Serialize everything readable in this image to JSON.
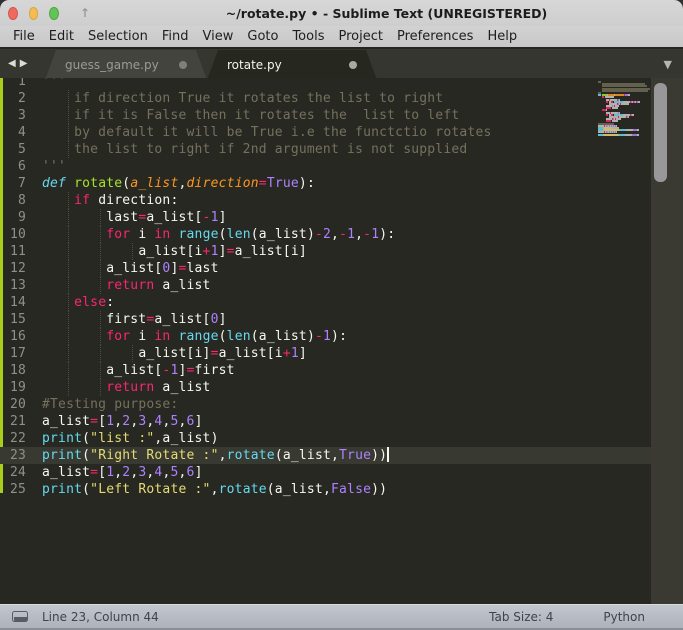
{
  "window": {
    "title": "~/rotate.py • - Sublime Text (UNREGISTERED)"
  },
  "menu": {
    "items": [
      "File",
      "Edit",
      "Selection",
      "Find",
      "View",
      "Goto",
      "Tools",
      "Project",
      "Preferences",
      "Help"
    ]
  },
  "tabs": [
    {
      "label": "guess_game.py",
      "active": false,
      "modified": true
    },
    {
      "label": "rotate.py",
      "active": true,
      "modified": true
    }
  ],
  "editor": {
    "cursor": {
      "line": 23,
      "column": 44
    },
    "current_line": 23,
    "colors": {
      "background": "#272822",
      "foreground": "#f8f8f2",
      "comment": "#75715e",
      "keyword": "#f92672",
      "builtin": "#66d9ef",
      "function_name": "#a6e22e",
      "parameter": "#fd971f",
      "number": "#ae81ff",
      "string": "#e6db74",
      "line_number": "#8f908a",
      "modified_indicator": "#a8ce1a",
      "current_line_bg": "#383931"
    },
    "lines": [
      {
        "n": 1,
        "tokens": [
          [
            "com",
            "'''"
          ]
        ]
      },
      {
        "n": 2,
        "tokens": [
          [
            "com",
            "    if direction True it rotates the list to right"
          ]
        ]
      },
      {
        "n": 3,
        "tokens": [
          [
            "com",
            "    if it is False then it rotates the  list to left"
          ]
        ]
      },
      {
        "n": 4,
        "tokens": [
          [
            "com",
            "    by default it will be True i.e the functctio rotates"
          ]
        ]
      },
      {
        "n": 5,
        "tokens": [
          [
            "com",
            "    the list to right if 2nd argument is not supplied"
          ]
        ]
      },
      {
        "n": 6,
        "tokens": [
          [
            "com",
            "'''"
          ]
        ]
      },
      {
        "n": 7,
        "tokens": [
          [
            "cyi",
            "def"
          ],
          [
            "fg",
            " "
          ],
          [
            "fn",
            "rotate"
          ],
          [
            "fg",
            "("
          ],
          [
            "par",
            "a_list"
          ],
          [
            "fg",
            ","
          ],
          [
            "par",
            "direction"
          ],
          [
            "kw",
            "="
          ],
          [
            "num",
            "True"
          ],
          [
            "fg",
            "):"
          ]
        ]
      },
      {
        "n": 8,
        "tokens": [
          [
            "fg",
            "    "
          ],
          [
            "kw",
            "if"
          ],
          [
            "fg",
            " direction:"
          ]
        ]
      },
      {
        "n": 9,
        "tokens": [
          [
            "fg",
            "        last"
          ],
          [
            "kw",
            "="
          ],
          [
            "fg",
            "a_list["
          ],
          [
            "kw",
            "-"
          ],
          [
            "num",
            "1"
          ],
          [
            "fg",
            "]"
          ]
        ]
      },
      {
        "n": 10,
        "tokens": [
          [
            "fg",
            "        "
          ],
          [
            "kw",
            "for"
          ],
          [
            "fg",
            " i "
          ],
          [
            "kw",
            "in"
          ],
          [
            "fg",
            " "
          ],
          [
            "cy",
            "range"
          ],
          [
            "fg",
            "("
          ],
          [
            "cy",
            "len"
          ],
          [
            "fg",
            "(a_list)"
          ],
          [
            "kw",
            "-"
          ],
          [
            "num",
            "2"
          ],
          [
            "fg",
            ","
          ],
          [
            "kw",
            "-"
          ],
          [
            "num",
            "1"
          ],
          [
            "fg",
            ","
          ],
          [
            "kw",
            "-"
          ],
          [
            "num",
            "1"
          ],
          [
            "fg",
            "):"
          ]
        ]
      },
      {
        "n": 11,
        "tokens": [
          [
            "fg",
            "            a_list[i"
          ],
          [
            "kw",
            "+"
          ],
          [
            "num",
            "1"
          ],
          [
            "fg",
            "]"
          ],
          [
            "kw",
            "="
          ],
          [
            "fg",
            "a_list[i]"
          ]
        ]
      },
      {
        "n": 12,
        "tokens": [
          [
            "fg",
            "        a_list["
          ],
          [
            "num",
            "0"
          ],
          [
            "fg",
            "]"
          ],
          [
            "kw",
            "="
          ],
          [
            "fg",
            "last"
          ]
        ]
      },
      {
        "n": 13,
        "tokens": [
          [
            "fg",
            "        "
          ],
          [
            "kw",
            "return"
          ],
          [
            "fg",
            " a_list"
          ]
        ]
      },
      {
        "n": 14,
        "tokens": [
          [
            "fg",
            "    "
          ],
          [
            "kw",
            "else"
          ],
          [
            "fg",
            ":"
          ]
        ]
      },
      {
        "n": 15,
        "tokens": [
          [
            "fg",
            "        first"
          ],
          [
            "kw",
            "="
          ],
          [
            "fg",
            "a_list["
          ],
          [
            "num",
            "0"
          ],
          [
            "fg",
            "]"
          ]
        ]
      },
      {
        "n": 16,
        "tokens": [
          [
            "fg",
            "        "
          ],
          [
            "kw",
            "for"
          ],
          [
            "fg",
            " i "
          ],
          [
            "kw",
            "in"
          ],
          [
            "fg",
            " "
          ],
          [
            "cy",
            "range"
          ],
          [
            "fg",
            "("
          ],
          [
            "cy",
            "len"
          ],
          [
            "fg",
            "(a_list)"
          ],
          [
            "kw",
            "-"
          ],
          [
            "num",
            "1"
          ],
          [
            "fg",
            "):"
          ]
        ]
      },
      {
        "n": 17,
        "tokens": [
          [
            "fg",
            "            a_list[i]"
          ],
          [
            "kw",
            "="
          ],
          [
            "fg",
            "a_list[i"
          ],
          [
            "kw",
            "+"
          ],
          [
            "num",
            "1"
          ],
          [
            "fg",
            "]"
          ]
        ]
      },
      {
        "n": 18,
        "tokens": [
          [
            "fg",
            "        a_list["
          ],
          [
            "kw",
            "-"
          ],
          [
            "num",
            "1"
          ],
          [
            "fg",
            "]"
          ],
          [
            "kw",
            "="
          ],
          [
            "fg",
            "first"
          ]
        ]
      },
      {
        "n": 19,
        "tokens": [
          [
            "fg",
            "        "
          ],
          [
            "kw",
            "return"
          ],
          [
            "fg",
            " a_list"
          ]
        ]
      },
      {
        "n": 20,
        "tokens": [
          [
            "com",
            "#Testing purpose:"
          ]
        ]
      },
      {
        "n": 21,
        "tokens": [
          [
            "fg",
            "a_list"
          ],
          [
            "kw",
            "="
          ],
          [
            "fg",
            "["
          ],
          [
            "num",
            "1"
          ],
          [
            "fg",
            ","
          ],
          [
            "num",
            "2"
          ],
          [
            "fg",
            ","
          ],
          [
            "num",
            "3"
          ],
          [
            "fg",
            ","
          ],
          [
            "num",
            "4"
          ],
          [
            "fg",
            ","
          ],
          [
            "num",
            "5"
          ],
          [
            "fg",
            ","
          ],
          [
            "num",
            "6"
          ],
          [
            "fg",
            "]"
          ]
        ]
      },
      {
        "n": 22,
        "tokens": [
          [
            "cy",
            "print"
          ],
          [
            "fg",
            "("
          ],
          [
            "str",
            "\"list :\""
          ],
          [
            "fg",
            ",a_list)"
          ]
        ]
      },
      {
        "n": 23,
        "tokens": [
          [
            "cy",
            "print"
          ],
          [
            "fg",
            "("
          ],
          [
            "str",
            "\"Right Rotate :\""
          ],
          [
            "fg",
            ","
          ],
          [
            "cy",
            "rotate"
          ],
          [
            "fg",
            "(a_list,"
          ],
          [
            "num",
            "True"
          ],
          [
            "fg",
            "))"
          ]
        ]
      },
      {
        "n": 24,
        "tokens": [
          [
            "fg",
            "a_list"
          ],
          [
            "kw",
            "="
          ],
          [
            "fg",
            "["
          ],
          [
            "num",
            "1"
          ],
          [
            "fg",
            ","
          ],
          [
            "num",
            "2"
          ],
          [
            "fg",
            ","
          ],
          [
            "num",
            "3"
          ],
          [
            "fg",
            ","
          ],
          [
            "num",
            "4"
          ],
          [
            "fg",
            ","
          ],
          [
            "num",
            "5"
          ],
          [
            "fg",
            ","
          ],
          [
            "num",
            "6"
          ],
          [
            "fg",
            "]"
          ]
        ]
      },
      {
        "n": 25,
        "tokens": [
          [
            "cy",
            "print"
          ],
          [
            "fg",
            "("
          ],
          [
            "str",
            "\"Left Rotate :\""
          ],
          [
            "fg",
            ","
          ],
          [
            "cy",
            "rotate"
          ],
          [
            "fg",
            "(a_list,"
          ],
          [
            "num",
            "False"
          ],
          [
            "fg",
            "))"
          ]
        ]
      }
    ]
  },
  "status": {
    "line_col": "Line 23, Column 44",
    "tab_size": "Tab Size: 4",
    "syntax": "Python"
  },
  "icons": {
    "tab_scroll_left": "◀",
    "tab_scroll_right": "▶",
    "tab_overflow": "▼",
    "window_up_arrow": "↑"
  }
}
